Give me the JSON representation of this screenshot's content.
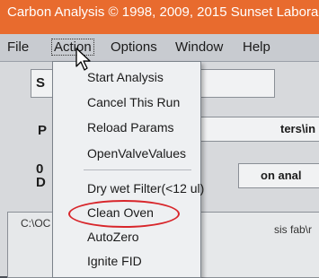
{
  "window": {
    "title": "Carbon Analysis © 1998, 2009, 2015 Sunset Labora"
  },
  "menubar": {
    "items": [
      "File",
      "Action",
      "Options",
      "Window",
      "Help"
    ]
  },
  "action_menu": {
    "items": [
      "Start Analysis",
      "Cancel This Run",
      "Reload Params",
      "OpenValveValues",
      "Dry wet Filter(<12 ul)",
      "Clean Oven",
      "AutoZero",
      "Ignite FID"
    ]
  },
  "background": {
    "label_s": "S",
    "label_p": "P",
    "label_0": "0",
    "label_d": "D",
    "field_params": "ters\\in",
    "field_analysis": "on anal",
    "panel_left": "C:\\OC",
    "panel_right": "sis fab\\r"
  },
  "highlight_color": "#d8262b"
}
